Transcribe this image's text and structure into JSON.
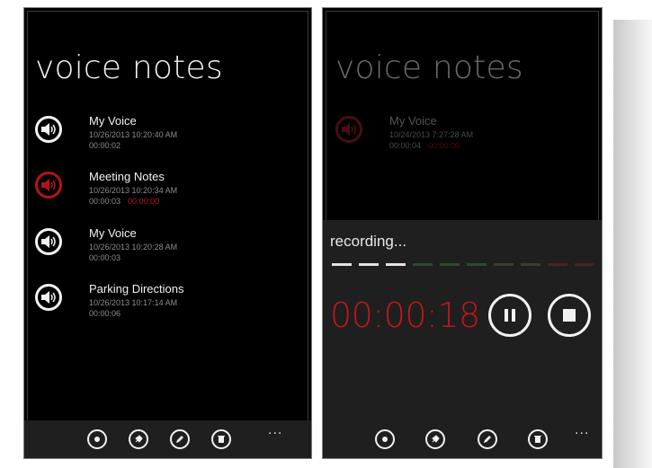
{
  "app": {
    "title": "voice notes"
  },
  "notes": [
    {
      "name": "My Voice",
      "date": "10/26/2013 10:20:40 AM",
      "duration": "00:00:02",
      "elapsed": "",
      "state": "normal"
    },
    {
      "name": "Meeting Notes",
      "date": "10/26/2013 10:20:34 AM",
      "duration": "00:00:03",
      "elapsed": "00:00:00",
      "state": "playing"
    },
    {
      "name": "My Voice",
      "date": "10/26/2013 10:20:28 AM",
      "duration": "00:00:03",
      "elapsed": "",
      "state": "normal"
    },
    {
      "name": "Parking Directions",
      "date": "10/26/2013 10:17:14 AM",
      "duration": "00:00:06",
      "elapsed": "",
      "state": "normal"
    }
  ],
  "right_screen": {
    "title": "voice notes",
    "note": {
      "name": "My Voice",
      "date": "10/24/2013 7:27:28 AM",
      "duration": "00:00:04",
      "elapsed": "00:00:00"
    },
    "recording_label": "recording...",
    "timer": "00:00:18",
    "level_segments_active": 3,
    "level_segments_total": 10
  },
  "appbar": {
    "buttons": [
      "record-icon",
      "pin-icon",
      "edit-icon",
      "delete-icon"
    ],
    "more": "..."
  },
  "colors": {
    "accent": "#c0161c",
    "background": "#000000",
    "appbar": "#1f1f1f",
    "foreground": "#f2f2f2"
  }
}
